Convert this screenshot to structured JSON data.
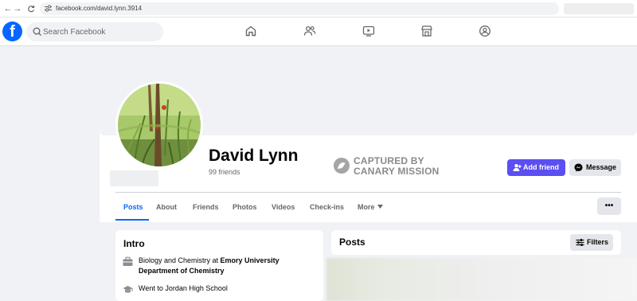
{
  "browser": {
    "url": "facebook.com/david.lynn.3914",
    "back_icon": "←",
    "forward_icon": "→",
    "reload_icon": "C"
  },
  "header": {
    "logo_letter": "f",
    "search_placeholder": "Search Facebook",
    "brand_color": "#0866ff"
  },
  "profile": {
    "name": "David Lynn",
    "friends": "99 friends",
    "watermark_line1": "CAPTURED BY",
    "watermark_line2": "CANARY MISSION",
    "add_friend_label": "Add friend",
    "message_label": "Message",
    "more_options": "•••"
  },
  "tabs": [
    {
      "label": "Posts",
      "active": true
    },
    {
      "label": "About"
    },
    {
      "label": "Friends"
    },
    {
      "label": "Photos"
    },
    {
      "label": "Videos"
    },
    {
      "label": "Check-ins"
    },
    {
      "label": "More"
    }
  ],
  "intro": {
    "title": "Intro",
    "education": {
      "prefix": "Biology and Chemistry at ",
      "school_line1": "Emory University",
      "school_line2": "Department of Chemistry"
    },
    "high_school": "Went to Jordan High School"
  },
  "posts": {
    "title": "Posts",
    "filters_label": "Filters"
  }
}
